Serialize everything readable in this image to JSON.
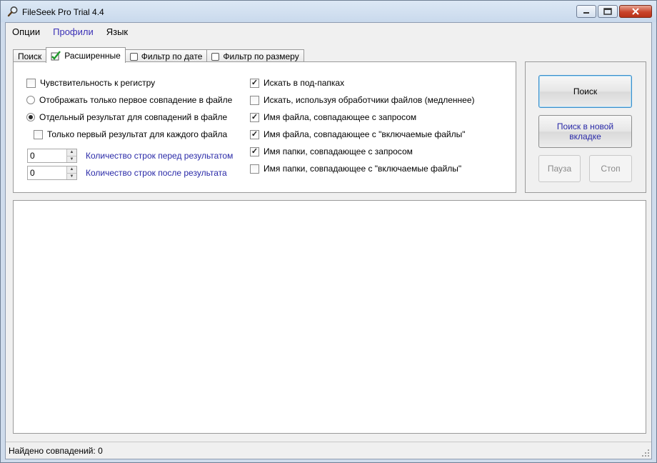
{
  "window": {
    "title": "FileSeek Pro Trial 4.4"
  },
  "menu": [
    {
      "label": "Опции"
    },
    {
      "label": "Профили"
    },
    {
      "label": "Язык"
    }
  ],
  "tabs": [
    {
      "label": "Поиск",
      "selected": false,
      "icon": ""
    },
    {
      "label": "Расширенные",
      "selected": true,
      "icon": "green-check-icon"
    },
    {
      "label": "Фильтр по дате",
      "selected": false,
      "icon": "checkbox-icon"
    },
    {
      "label": "Фильтр по размеру",
      "selected": false,
      "icon": "checkbox-icon"
    }
  ],
  "advanced": {
    "case_sensitive": {
      "label": "Чувствительность к регистру",
      "checked": false
    },
    "first_match_only": {
      "label": "Отображать только первое совпадение в файле",
      "selected": false
    },
    "separate_result": {
      "label": "Отдельный результат для совпадений в файле",
      "selected": true
    },
    "first_result_each_file": {
      "label": "Только первый результат для каждого файла",
      "checked": false
    },
    "lines_before": {
      "value": "0",
      "label": "Количество строк перед результатом"
    },
    "lines_after": {
      "value": "0",
      "label": "Количество строк после результата"
    },
    "search_subfolders": {
      "label": "Искать в под-папках",
      "checked": true
    },
    "use_file_handlers": {
      "label": "Искать, используя обработчики файлов (медленнее)",
      "checked": false
    },
    "filename_match_query": {
      "label": "Имя файла, совпадающее с запросом",
      "checked": true
    },
    "filename_match_include": {
      "label": "Имя файла, совпадающее с \"включаемые файлы\"",
      "checked": true
    },
    "foldername_match_query": {
      "label": "Имя папки, совпадающее с запросом",
      "checked": true
    },
    "foldername_match_include": {
      "label": "Имя папки, совпадающее с \"включаемые файлы\"",
      "checked": false
    }
  },
  "buttons": {
    "search": "Поиск",
    "search_new_tab": "Поиск в новой вкладке",
    "pause": "Пауза",
    "stop": "Стоп"
  },
  "status": {
    "text": "Найдено совпадений: 0"
  }
}
